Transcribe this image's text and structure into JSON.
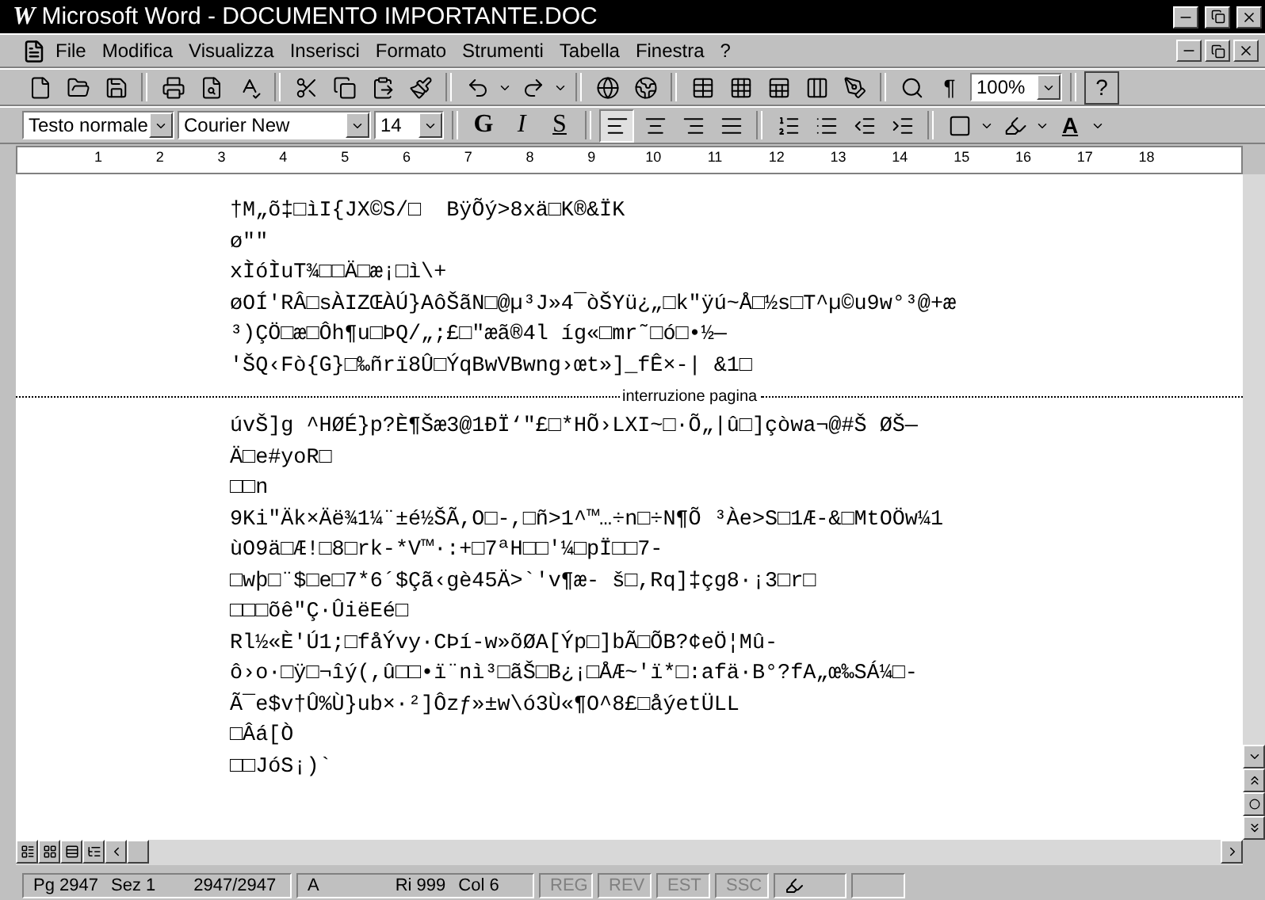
{
  "window": {
    "logo": "W",
    "title": "Microsoft Word - DOCUMENTO IMPORTANTE.DOC"
  },
  "menu": [
    {
      "label": "File"
    },
    {
      "label": "Modifica"
    },
    {
      "label": "Visualizza"
    },
    {
      "label": "Inserisci"
    },
    {
      "label": "Formato"
    },
    {
      "label": "Strumenti"
    },
    {
      "label": "Tabella"
    },
    {
      "label": "Finestra"
    },
    {
      "label": "?"
    }
  ],
  "standard_toolbar": {
    "pilcrow": "¶",
    "zoom": "100%",
    "help": "?"
  },
  "formatting_toolbar": {
    "style": "Testo normale",
    "font": "Courier New",
    "size": "14",
    "bold": "G",
    "italic": "I",
    "underline": "S",
    "font_color": "A",
    "alignments": [
      {
        "kind": "left",
        "selected": true
      },
      {
        "kind": "center",
        "selected": false
      },
      {
        "kind": "right",
        "selected": false
      },
      {
        "kind": "justify",
        "selected": false
      }
    ]
  },
  "ruler": {
    "marks": [
      "1",
      "2",
      "3",
      "4",
      "5",
      "6",
      "7",
      "8",
      "9",
      "10",
      "11",
      "12",
      "13",
      "14",
      "15",
      "16",
      "17",
      "18"
    ]
  },
  "document": {
    "lines_before_break": [
      "†M„õ‡□ìI{JX©S/□  BÿÕý>8xä□K®&ÏK",
      "ø\"\"",
      "xÌóÌuT¾□□Ä□æ¡□ì\\+",
      "øOÍ'RÂ□sÀIZŒÀÚ}AôŠãN□@µ³J»4¯òŠYü¿„□k\"ÿú~Å□½s□T^µ©u9w°³@+æ",
      "³)ÇÖ□æ□Ôh¶u□ÞQ/„;£□\"æã®4l íg«□mr˜□ó□•½—",
      "'ŠQ‹Fò{G}□‰ñrï8Û□ÝqBwVBwng›œt»]_fÊ×-| &1□"
    ],
    "page_break": "interruzione pagina",
    "lines_after_break": [
      "úvŠ]g ^HØÉ}p?È¶Šæ3@1ÐÏ‘\"£□*HÕ›LXI~□·Õ„|û□]çòwa¬@#Š ØŠ—",
      "Ä□e#yoR□",
      "□□n",
      "9Ki\"Äk×Äë¾1¼¨±é½ŠÃ,O□-,□ñ>1^™…÷n□÷N¶Õ ³Àe>S□1Æ-&□MtOÖw¼1",
      "ùO9ä□Æ!□8□rk-*V™·:+□7ªH□□'¼□pÏ□□7-",
      "□wþ□¨$□e□7*6´$Çã‹gè45Ä>`'v¶æ- š□,Rq]‡çg8·¡3□r□",
      "□□□õê\"Ç·ÛiëEé□",
      "Rl½«È'Ú1;□fåÝvy·CÞí-w»õØA[Ýp□]bÃ□ÕB?¢eÖ¦Mû-",
      "ô›o·□ÿ□¬îý(,û□□•ï¨nì³□ãŠ□B¿¡□ÅÆ~'ï*□:afä·B°?fA„œ‰SÁ¼□-",
      "Ã‾e$v†Û%Ù}ub×·²]Ôzƒ»±w\\ó3Ù«¶O^8£□åýetÜLL",
      "□Âá[Ò",
      "□□JóS¡)`"
    ]
  },
  "status_bar": {
    "page": "Pg 2947",
    "section": "Sez 1",
    "pages": "2947/2947",
    "at": "A",
    "line": "Ri 999",
    "column": "Col 6",
    "modes": [
      {
        "label": "REG",
        "on": false
      },
      {
        "label": "REV",
        "on": false
      },
      {
        "label": "EST",
        "on": false
      },
      {
        "label": "SSC",
        "on": false
      }
    ]
  }
}
